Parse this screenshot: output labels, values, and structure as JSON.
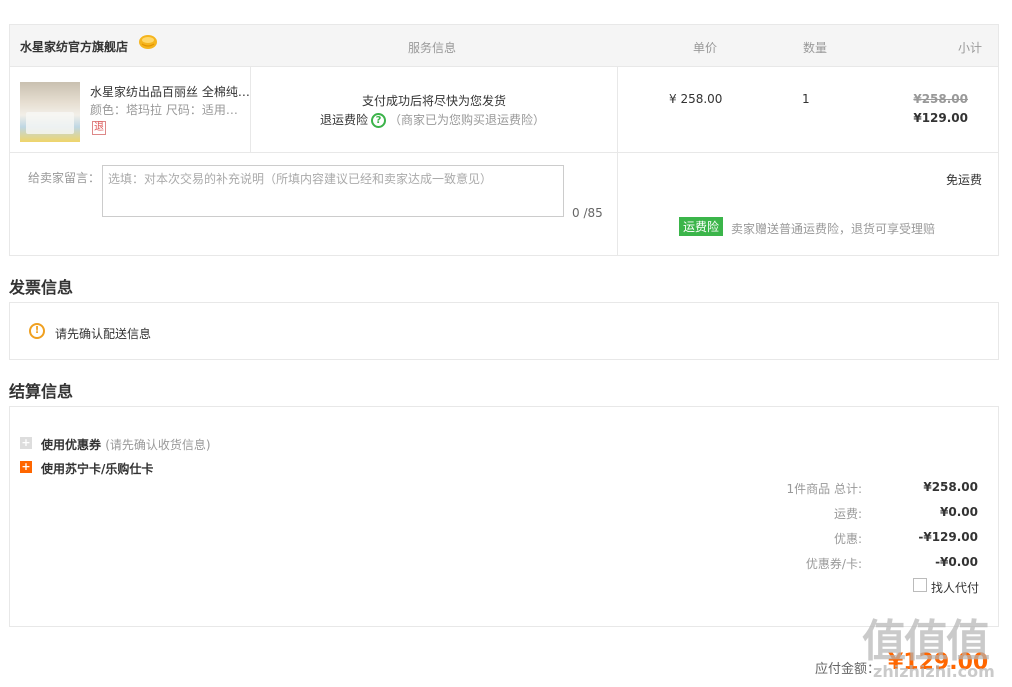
{
  "order": {
    "store_name": "水星家纺官方旗舰店",
    "columns": {
      "service": "服务信息",
      "unit_price": "单价",
      "quantity": "数量",
      "subtotal": "小计"
    },
    "product": {
      "title": "水星家纺出品百丽丝 全棉纯…",
      "attributes": "颜色：塔玛拉   尺码：适用…",
      "refund_tag": "退",
      "service_line1": "支付成功后将尽快为您发货",
      "service_insurance_label": "退运费险",
      "service_insurance_icon": "?",
      "service_insurance_note": "（商家已为您购买退运费险）",
      "unit_price": "¥ 258.00",
      "quantity": "1",
      "original_price": "¥258.00",
      "subtotal": "¥129.00"
    },
    "message": {
      "label": "给卖家留言：",
      "placeholder": "选填：对本次交易的补充说明（所填内容建议已经和卖家达成一致意见）",
      "counter": "0 /85"
    },
    "shipping": {
      "fee": "免运费",
      "insurance_badge": "运费险",
      "insurance_text": "卖家赠送普通运费险，退货可享受理赔"
    }
  },
  "invoice": {
    "title": "发票信息",
    "warning_icon": "!",
    "warning": "请先确认配送信息"
  },
  "settlement": {
    "title": "结算信息",
    "coupon_label": "使用优惠券",
    "coupon_note": "(请先确认收货信息)",
    "card_label": "使用苏宁卡/乐购仕卡",
    "plus_icon": "+",
    "summary": {
      "items_label": "1件商品 总计:",
      "items_value": "¥258.00",
      "shipping_label": "运费:",
      "shipping_value": "¥0.00",
      "discount_label": "优惠:",
      "discount_value": "-¥129.00",
      "coupon_label": "优惠券/卡:",
      "coupon_value": "-¥0.00",
      "helper_label": "找人代付"
    },
    "due_label": "应付金额：",
    "due_value": "¥129.00"
  },
  "watermark": {
    "main": "值值值",
    "sub": "zhizhizhi.com"
  },
  "colors": {
    "accent": "#ff6600",
    "green": "#3bb54a",
    "warning": "#f0a020",
    "border": "#e8e8e8"
  }
}
